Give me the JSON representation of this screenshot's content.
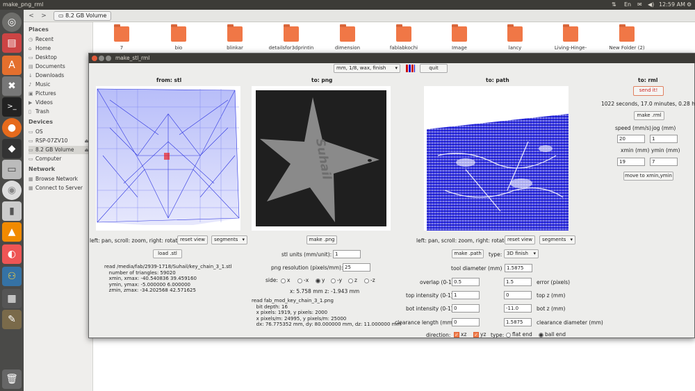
{
  "topbar": {
    "window_title": "make_png_rml",
    "indicators": [
      "⇅",
      "En",
      "✉",
      "◀)",
      "12:59 AM",
      "⚙"
    ]
  },
  "launcher": {
    "items": [
      "dash",
      "files",
      "software-center",
      "settings",
      "terminal",
      "firefox",
      "inkscape",
      "drive",
      "disc",
      "usb",
      "vlc",
      "blender",
      "python",
      "calc",
      "gimp",
      "trash"
    ]
  },
  "nautilus": {
    "breadcrumb": "8.2 GB Volume",
    "sidebar": {
      "places_title": "Places",
      "places": [
        "Recent",
        "Home",
        "Desktop",
        "Documents",
        "Downloads",
        "Music",
        "Pictures",
        "Videos",
        "Trash"
      ],
      "devices_title": "Devices",
      "devices": [
        "OS",
        "RSP-07ZV10",
        "8.2 GB Volume",
        "Computer"
      ],
      "network_title": "Network",
      "network": [
        "Browse Network",
        "Connect to Server"
      ]
    },
    "folders": [
      "7",
      "bio",
      "blinkar",
      "detailsfor3dprintin",
      "dimension",
      "fablabkochi",
      "Image",
      "lancy",
      "Living-Hinge-",
      "New Folder (2)"
    ]
  },
  "window": {
    "title": "make_stl_rml",
    "toolbar": {
      "process_select": "mm, 1/8, wax, finish",
      "quit_label": "quit"
    },
    "stl": {
      "header": "from: stl",
      "hint": "left: pan, scroll: zoom, right: rotate",
      "reset_view": "reset view",
      "display_mode": "segments",
      "load_label": "load .stl",
      "info": "read /media/fab/2939-1718/Suhail/key_chain_3_1.stl\n   number of triangles: 59020\n   xmin, xmax: -40.540836 39.459160\n   ymin, ymax: -5.000000 6.000000\n   zmin, zmax: -34.202568 42.571625"
    },
    "png": {
      "header": "to: png",
      "star_text": "Suhail",
      "make_label": "make .png",
      "units_label": "stl units (mm/unit):",
      "units_value": "1",
      "resolution_label": "png resolution (pixels/mm):",
      "resolution_value": "25",
      "side_label": "side:",
      "sides": [
        "x",
        "-x",
        "y",
        "-y",
        "z",
        "-z"
      ],
      "selected_side": "y",
      "coord_readout": "x: 5.758 mm  z: -1.943 mm",
      "info": "read fab_mod_key_chain_3_1.png\n   bit depth: 16\n   x pixels: 1919, y pixels: 2000\n   x pixels/m: 24995, y pixels/m: 25000\n   dx: 76.775352 mm, dy: 80.000000 mm, dz: 11.000000 mm"
    },
    "path": {
      "header": "to: path",
      "hint": "left: pan, scroll: zoom, right: rotate",
      "reset_view": "reset view",
      "display_mode": "segments",
      "make_label": "make .path",
      "type_label": "type:",
      "type_value": "3D finish",
      "tool_diameter_label": "tool diameter (mm)",
      "tool_diameter": "1.5875",
      "overlap_label": "overlap (0-1)",
      "overlap": "0.5",
      "error_label": "error (pixels)",
      "error": "1.5",
      "top_intensity_label": "top intensity (0-1)",
      "top_intensity": "1",
      "top_z_label": "top z (mm)",
      "top_z": "0",
      "bot_intensity_label": "bot intensity (0-1)",
      "bot_intensity": "0",
      "bot_z_label": "bot z (mm)",
      "bot_z": "-11.0",
      "clearance_length_label": "clearance length (mm)",
      "clearance_length": "0",
      "clearance_diameter_label": "clearance diameter (mm)",
      "clearance_diameter": "1.5875",
      "direction_label": "direction:",
      "dir_xz": "xz",
      "dir_yz": "yz",
      "type2_label": "type:",
      "flat_end": "flat end",
      "ball_end": "ball end"
    },
    "rml": {
      "header": "to: rml",
      "send_label": "send it!",
      "time_estimate": "1022 seconds, 17.0 minutes, 0.28 hours",
      "make_label": "make .rml",
      "speed_label": "speed (mm/s)",
      "jog_label": "jog (mm)",
      "speed": "20",
      "jog": "1",
      "xmin_label": "xmin (mm)",
      "ymin_label": "ymin (mm)",
      "xmin": "19",
      "ymin": "7",
      "move_label": "move to xmin,ymin"
    }
  }
}
